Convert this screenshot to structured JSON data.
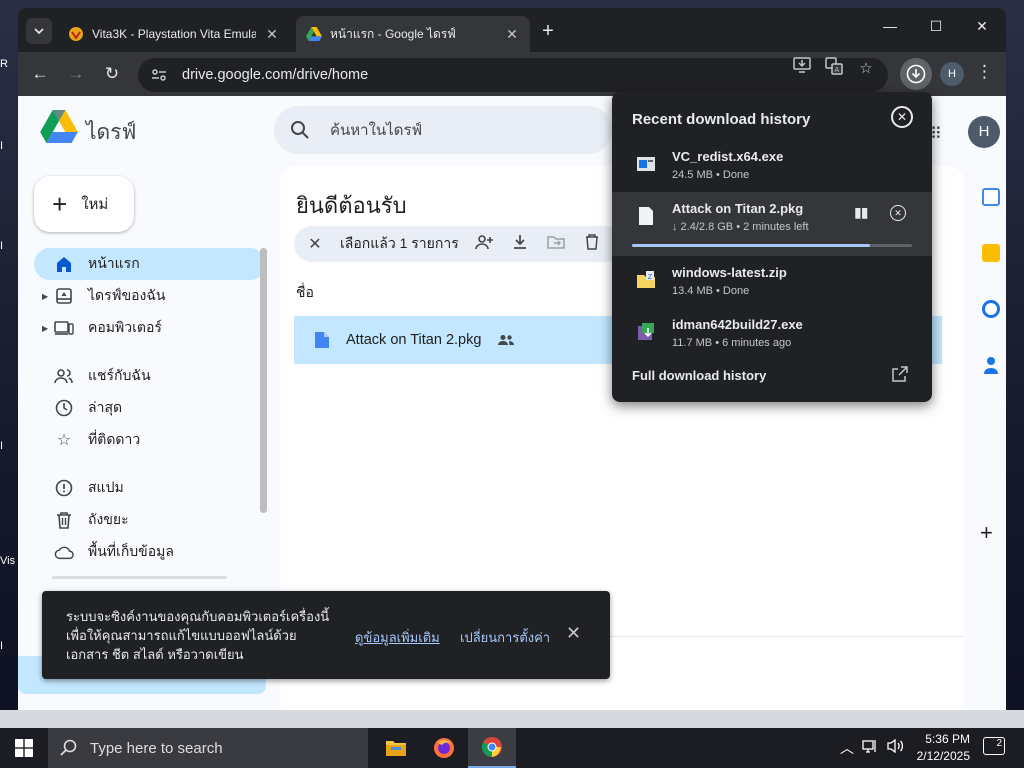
{
  "browser": {
    "tabs": [
      {
        "title": "Vita3K - Playstation Vita Emulat",
        "active": false
      },
      {
        "title": "หน้าแรก - Google ไดรฟ์",
        "active": true
      }
    ],
    "url": "drive.google.com/drive/home",
    "profile_initial": "H"
  },
  "drive": {
    "brand": "ไดรฟ์",
    "search_placeholder": "ค้นหาในไดรฟ์",
    "new_label": "ใหม่",
    "avatar_initial": "H",
    "nav": [
      {
        "label": "หน้าแรก",
        "icon": "home-icon",
        "active": true
      },
      {
        "label": "ไดรฟ์ของฉัน",
        "icon": "my-drive-icon"
      },
      {
        "label": "คอมพิวเตอร์",
        "icon": "computer-icon"
      },
      {
        "label": "แชร์กับฉัน",
        "icon": "shared-icon"
      },
      {
        "label": "ล่าสุด",
        "icon": "clock-icon"
      },
      {
        "label": "ที่ติดดาว",
        "icon": "star-icon"
      },
      {
        "label": "สแปม",
        "icon": "spam-icon"
      },
      {
        "label": "ถังขยะ",
        "icon": "trash-icon"
      },
      {
        "label": "พื้นที่เก็บข้อมูล",
        "icon": "cloud-icon"
      }
    ],
    "welcome": "ยินดีต้อนรับ",
    "selection_text": "เลือกแล้ว 1 รายการ",
    "column_name": "ชื่อ",
    "file": {
      "name": "Attack on Titan 2.pkg"
    }
  },
  "snackbar": {
    "message": "ระบบจะซิงค์งานของคุณกับคอมพิวเตอร์เครื่องนี้ เพื่อให้คุณสามารถแก้ไขแบบออฟไลน์ด้วย เอกสาร ชีต สไลด์ หรือวาดเขียน",
    "link": "ดูข้อมูลเพิ่มเติม",
    "action": "เปลี่ยนการตั้งค่า"
  },
  "downloads": {
    "title": "Recent download history",
    "items": [
      {
        "name": "VC_redist.x64.exe",
        "status": "24.5 MB • Done"
      },
      {
        "name": "Attack on Titan 2.pkg",
        "status": "↓ 2.4/2.8 GB • 2 minutes left",
        "progress": 0.85
      },
      {
        "name": "windows-latest.zip",
        "status": "13.4 MB • Done"
      },
      {
        "name": "idman642build27.exe",
        "status": "11.7 MB • 6 minutes ago"
      }
    ],
    "full_history": "Full download history"
  },
  "taskbar": {
    "search_placeholder": "Type here to search",
    "time": "5:36 PM",
    "date": "2/12/2025",
    "notifications": "2"
  },
  "colors": {
    "accent": "#c2e7ff",
    "chrome_dark": "#202124",
    "progress": "#a8c7fa"
  }
}
